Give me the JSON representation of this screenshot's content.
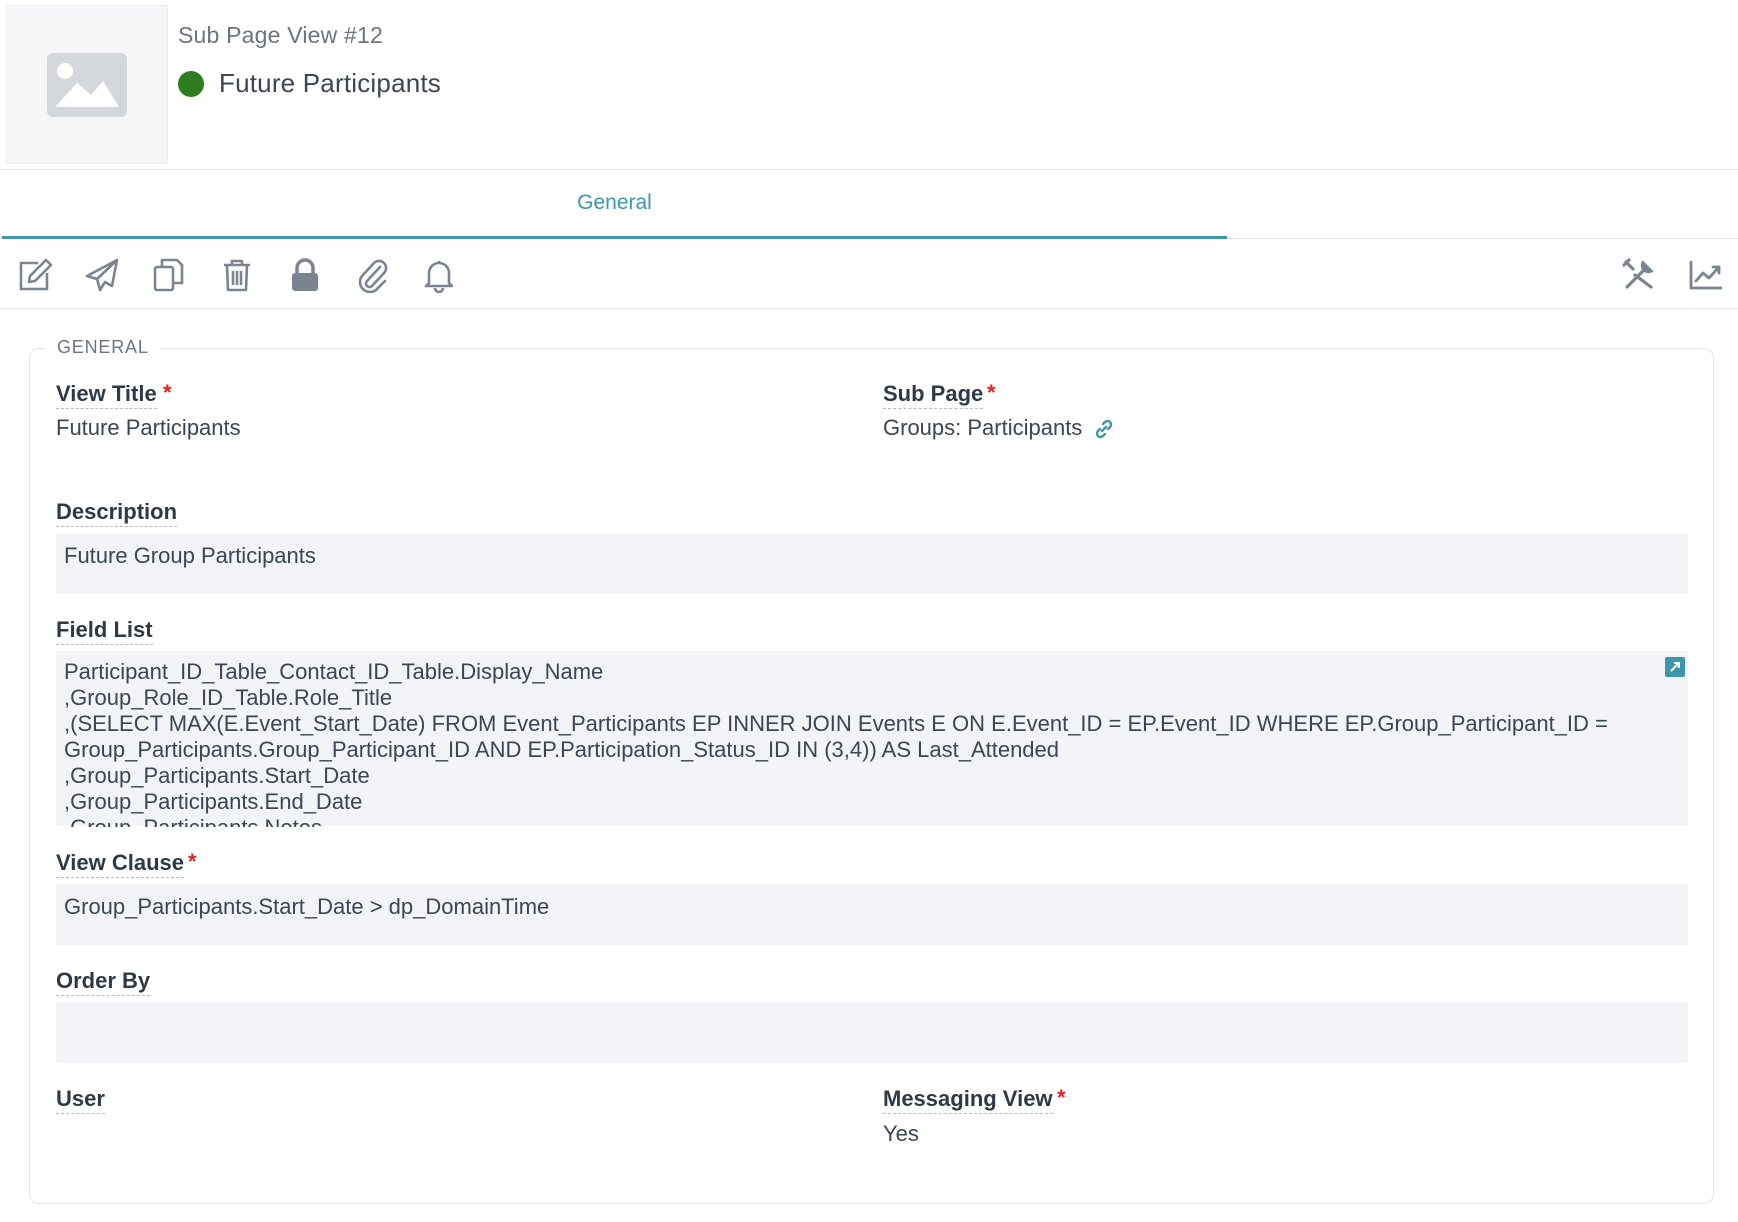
{
  "header": {
    "subtitle": "Sub Page View #12",
    "title": "Future Participants",
    "status_color": "#2e7d1e"
  },
  "tabs": [
    {
      "label": "General",
      "active": true
    }
  ],
  "toolbar": {
    "left": [
      "edit-icon",
      "send-icon",
      "copy-icon",
      "delete-icon",
      "lock-icon",
      "attach-icon",
      "bell-icon"
    ],
    "right": [
      "tools-icon",
      "chart-icon"
    ]
  },
  "section": {
    "legend": "GENERAL"
  },
  "fields": {
    "view_title": {
      "label": "View Title",
      "value": "Future Participants",
      "required": true
    },
    "sub_page": {
      "label": "Sub Page",
      "value": "Groups: Participants",
      "required": true
    },
    "description": {
      "label": "Description",
      "value": "Future Group Participants"
    },
    "field_list": {
      "label": "Field List",
      "value": "Participant_ID_Table_Contact_ID_Table.Display_Name\n,Group_Role_ID_Table.Role_Title\n,(SELECT MAX(E.Event_Start_Date) FROM Event_Participants EP INNER JOIN Events E ON E.Event_ID = EP.Event_ID WHERE EP.Group_Participant_ID = Group_Participants.Group_Participant_ID AND EP.Participation_Status_ID IN (3,4)) AS Last_Attended\n,Group_Participants.Start_Date\n,Group_Participants.End_Date\n,Group_Participants.Notes"
    },
    "view_clause": {
      "label": "View Clause",
      "value": "Group_Participants.Start_Date > dp_DomainTime",
      "required": true
    },
    "order_by": {
      "label": "Order By",
      "value": ""
    },
    "user": {
      "label": "User",
      "value": ""
    },
    "messaging_view": {
      "label": "Messaging View",
      "value": "Yes",
      "required": true
    }
  },
  "colors": {
    "accent": "#3d96ab",
    "required": "#e02424",
    "field_bg": "#f3f4f7"
  }
}
